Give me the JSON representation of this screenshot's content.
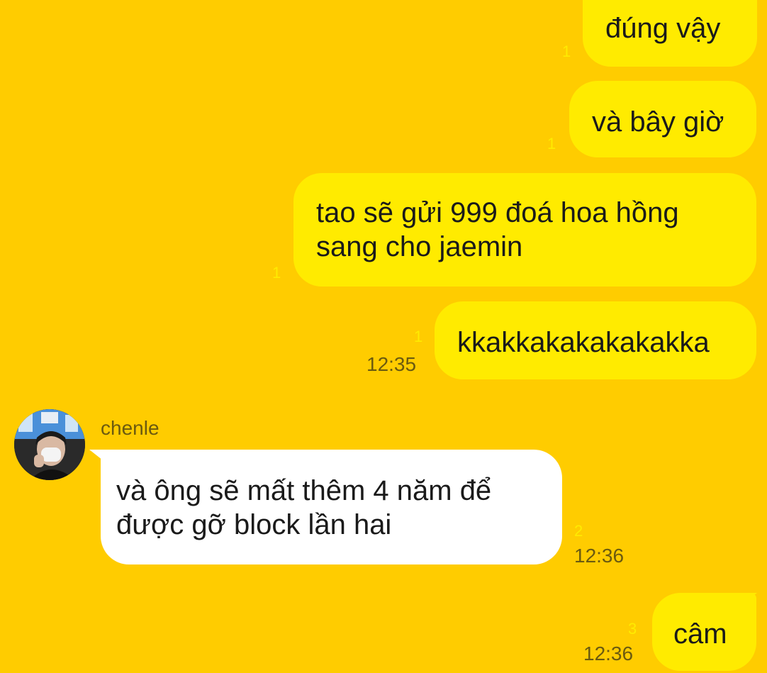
{
  "messages": [
    {
      "text": "đúng vậy",
      "unread": "1"
    },
    {
      "text": "và bây giờ",
      "unread": "1"
    },
    {
      "line1": "tao sẽ gửi 999 đoá hoa hồng",
      "line2": "sang cho jaemin",
      "unread": "1"
    },
    {
      "text": "kkakkakakakakakka",
      "unread": "1",
      "time": "12:35"
    },
    {
      "sender": "chenle",
      "line1": "và ông sẽ mất thêm 4 năm để",
      "line2": "được gỡ block lần hai",
      "unread": "2",
      "time": "12:36"
    },
    {
      "text": "câm",
      "unread": "3",
      "time": "12:36"
    }
  ],
  "colors": {
    "background": "#FFCC00",
    "outgoing_bubble": "#FFEB00",
    "incoming_bubble": "#FFFFFF",
    "unread_count": "#FFEB00",
    "meta_text": "#6b5a10"
  }
}
